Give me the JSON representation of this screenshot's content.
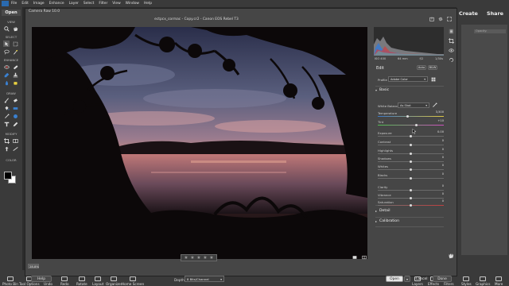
{
  "host": {
    "menu": [
      "File",
      "Edit",
      "Image",
      "Enhance",
      "Layer",
      "Select",
      "Filter",
      "View",
      "Window",
      "Help"
    ],
    "open_label": "Open",
    "sections": {
      "view": "VIEW",
      "select": "SELECT",
      "enhance": "ENHANCE",
      "draw": "DRAW",
      "modify": "MODIFY",
      "color": "COLOR"
    },
    "create_label": "Create",
    "share_label": "Share",
    "opacity_placeholder": "Opacity:",
    "taskbar_left": [
      "Photo Bin",
      "Tool Options",
      "Undo",
      "Redo",
      "Rotate",
      "Layout",
      "Organizer",
      "Home Screen"
    ],
    "taskbar_right": [
      "Layers",
      "Effects",
      "Filters",
      "Styles",
      "Graphics",
      "More"
    ]
  },
  "dialog": {
    "title": "Camera Raw 10.0",
    "subtitle": "ectpcx_cormac - Copy.cr2  -  Canon EOS Rebel T3",
    "zoom": "28.8%",
    "help_label": "Help",
    "depth_label": "Depth:",
    "depth_value": "8 Bits/Channel",
    "open_label": "Open",
    "cancel_label": "Cancel",
    "done_label": "Done",
    "histogram_info": [
      "ISO 400",
      "64 mm",
      "f/2",
      "1/30s"
    ],
    "edit_title": "Edit",
    "auto_label": "Auto",
    "bw_label": "B&W",
    "profile_label": "Profile",
    "profile_value": "Adobe Color",
    "basic_title": "Basic",
    "wb_label": "White Balance",
    "wb_value": "As Shot",
    "sliders": [
      {
        "label": "Temperature",
        "value": "3,500",
        "pos": 0.45,
        "track": "temp"
      },
      {
        "label": "Tint",
        "value": "+10",
        "pos": 0.58,
        "track": "tint"
      },
      {
        "label": "Exposure",
        "value": "0.00",
        "pos": 0.5,
        "track": ""
      },
      {
        "label": "Contrast",
        "value": "0",
        "pos": 0.5,
        "track": ""
      },
      {
        "label": "Highlights",
        "value": "0",
        "pos": 0.5,
        "track": ""
      },
      {
        "label": "Shadows",
        "value": "0",
        "pos": 0.5,
        "track": ""
      },
      {
        "label": "Whites",
        "value": "0",
        "pos": 0.5,
        "track": ""
      },
      {
        "label": "Blacks",
        "value": "0",
        "pos": 0.5,
        "track": ""
      },
      {
        "label": "Clarity",
        "value": "0",
        "pos": 0.5,
        "track": ""
      },
      {
        "label": "Vibrance",
        "value": "0",
        "pos": 0.5,
        "track": ""
      },
      {
        "label": "Saturation",
        "value": "0",
        "pos": 0.5,
        "track": "sat"
      }
    ],
    "detail_title": "Detail",
    "calibration_title": "Calibration"
  },
  "colors": {
    "accent": "#2a6ab0",
    "panel": "#464646",
    "app_bg": "#3a3a3a"
  }
}
